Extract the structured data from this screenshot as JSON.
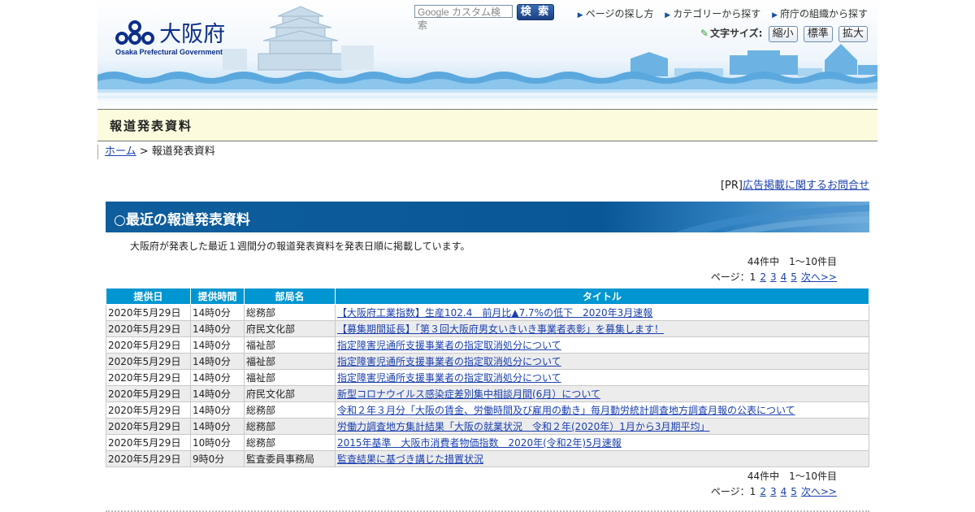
{
  "header": {
    "logo_text": "大阪府",
    "logo_sub": "Osaka Prefectural Government",
    "search_placeholder": "Google カスタム検索",
    "search_button": "検 索",
    "links": [
      "ページの探し方",
      "カテゴリーから探す",
      "府庁の組織から探す"
    ],
    "font_size_label": "文字サイズ:",
    "font_size_buttons": [
      "縮小",
      "標準",
      "拡大"
    ]
  },
  "title_band": "報道発表資料",
  "breadcrumb": {
    "home": "ホーム",
    "separator": " > ",
    "current": "報道発表資料"
  },
  "pr": {
    "prefix": "[PR]",
    "link": "広告掲載に関するお問合せ"
  },
  "section_title": "○最近の報道発表資料",
  "description": "大阪府が発表した最近１週間分の報道発表資料を発表日順に掲載しています。",
  "count_text": "44件中　1～10件目",
  "pager": {
    "label": "ページ：1",
    "pages": [
      "2",
      "3",
      "4",
      "5"
    ],
    "next": "次へ>>"
  },
  "table": {
    "headers": [
      "提供日",
      "提供時間",
      "部局名",
      "タイトル"
    ],
    "rows": [
      [
        "2020年5月29日",
        "14時0分",
        "総務部",
        "【大阪府工業指数】生産102.4　前月比▲7.7%の低下　2020年3月速報"
      ],
      [
        "2020年5月29日",
        "14時0分",
        "府民文化部",
        "【募集期間延長】「第３回大阪府男女いきいき事業者表彰」を募集します！"
      ],
      [
        "2020年5月29日",
        "14時0分",
        "福祉部",
        "指定障害児通所支援事業者の指定取消処分について"
      ],
      [
        "2020年5月29日",
        "14時0分",
        "福祉部",
        "指定障害児通所支援事業者の指定取消処分について"
      ],
      [
        "2020年5月29日",
        "14時0分",
        "福祉部",
        "指定障害児通所支援事業者の指定取消処分について"
      ],
      [
        "2020年5月29日",
        "14時0分",
        "府民文化部",
        "新型コロナウイルス感染症差別集中相談月間(6月）について"
      ],
      [
        "2020年5月29日",
        "14時0分",
        "総務部",
        "令和２年３月分「大阪の賃金、労働時間及び雇用の動き」毎月勤労統計調査地方調査月報の公表について"
      ],
      [
        "2020年5月29日",
        "14時0分",
        "総務部",
        "労働力調査地方集計結果「大阪の就業状況　令和２年(2020年）1月から3月期平均」"
      ],
      [
        "2020年5月29日",
        "10時0分",
        "総務部",
        "2015年基準　大阪市消費者物価指数　2020年(令和2年)5月速報"
      ],
      [
        "2020年5月29日",
        "9時0分",
        "監査委員事務局",
        "監査結果に基づき講じた措置状況"
      ]
    ]
  },
  "colors": {
    "header_blue": "#0b2e8a",
    "section_blue": "#0a5797",
    "table_head": "#0096d1",
    "link": "#1a3fb0"
  }
}
